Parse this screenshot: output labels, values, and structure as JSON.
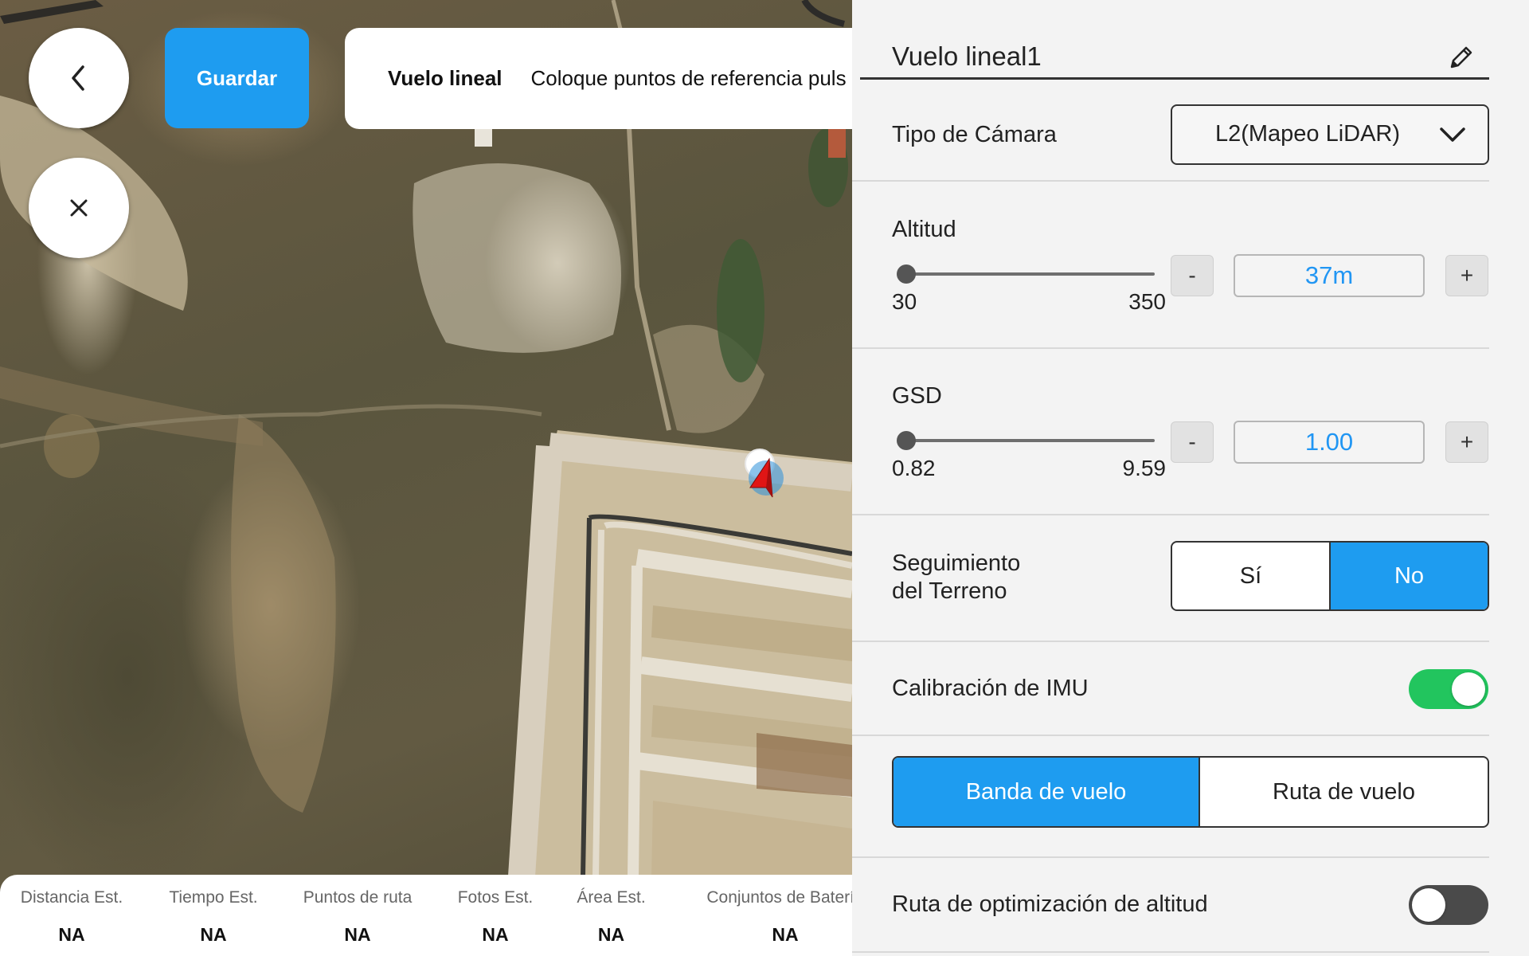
{
  "map": {
    "save_label": "Guardar",
    "info_title": "Vuelo lineal",
    "info_text": "Coloque puntos de referencia puls",
    "stats": [
      {
        "label": "Distancia Est.",
        "value": "NA"
      },
      {
        "label": "Tiempo Est.",
        "value": "NA"
      },
      {
        "label": "Puntos de ruta",
        "value": "NA"
      },
      {
        "label": "Fotos Est.",
        "value": "NA"
      },
      {
        "label": "Área Est.",
        "value": "NA"
      },
      {
        "label": "Conjuntos de Batería",
        "value": "NA"
      }
    ]
  },
  "panel": {
    "route_name": "Vuelo lineal1",
    "camera": {
      "label": "Tipo de Cámara",
      "value": "L2(Mapeo LiDAR)"
    },
    "altitude": {
      "label": "Altitud",
      "min": "30",
      "max": "350",
      "value": "37m",
      "minus": "-",
      "plus": "+",
      "level": 0.02
    },
    "gsd": {
      "label": "GSD",
      "min": "0.82",
      "max": "9.59",
      "value": "1.00",
      "minus": "-",
      "plus": "+",
      "level": 0.02
    },
    "terrain": {
      "label_line1": "Seguimiento",
      "label_line2": "del Terreno",
      "yes": "Sí",
      "no": "No",
      "selected": "No"
    },
    "imu": {
      "label": "Calibración de IMU",
      "on": true
    },
    "mode": {
      "band": "Banda de vuelo",
      "route": "Ruta de vuelo",
      "selected": "Banda de vuelo"
    },
    "altitude_opt": {
      "label": "Ruta de optimización de altitud",
      "on": false
    }
  },
  "colors": {
    "accent": "#1e9cf0",
    "toggle_on": "#22c55e",
    "toggle_off": "#4a4a4a",
    "value_text": "#2196f3"
  }
}
